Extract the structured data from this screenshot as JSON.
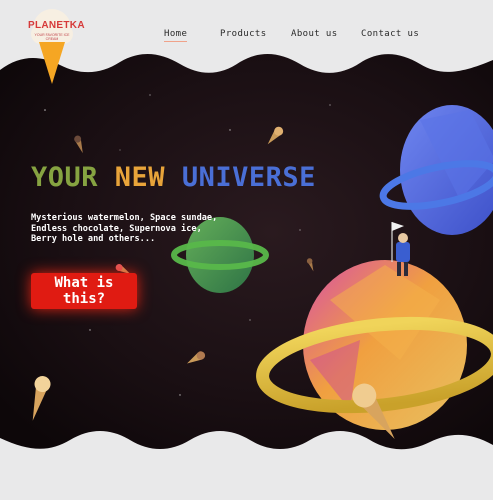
{
  "brand": {
    "name": "PLANETKA",
    "tagline": "YOUR FAVORITE ICE CREAM"
  },
  "nav": {
    "home": "Home",
    "products": "Products",
    "about": "About us",
    "contact": "Contact us"
  },
  "hero": {
    "title_word1": "YOUR",
    "title_word2": "NEW",
    "title_word3": "UNIVERSE",
    "description_line1": "Mysterious watermelon, Space sundae,",
    "description_line2": "Endless chocolate, Supernova ice,",
    "description_line3": "Berry hole and others...",
    "cta_label": "What is this?"
  },
  "colors": {
    "background": "#e9e9ea",
    "space": "#1a0e12",
    "title_green": "#86a341",
    "title_orange": "#e8a43a",
    "title_blue": "#4a6fd6",
    "cta_red": "#e01b12",
    "logo_red": "#d63a3a",
    "cone": "#f5a623"
  },
  "icons": [
    "ice-cream-cone-icon",
    "planet-icon",
    "astronaut-icon",
    "flag-icon"
  ]
}
